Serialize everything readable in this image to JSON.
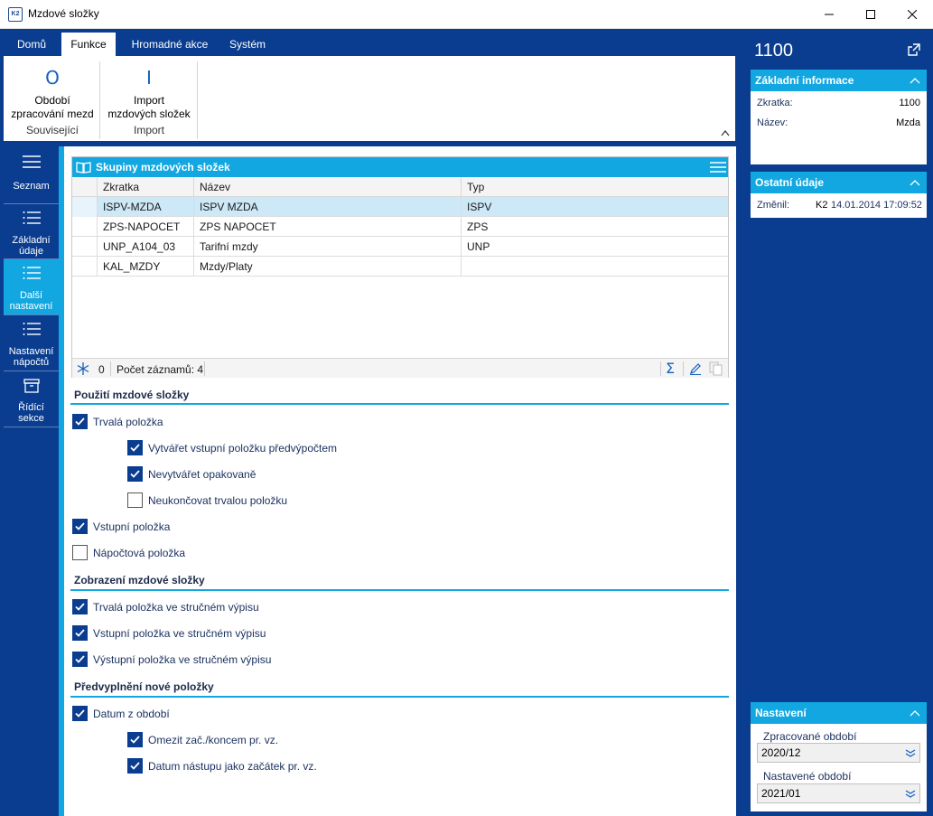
{
  "window": {
    "title": "Mzdové složky",
    "icon_text": "K2"
  },
  "ribbon": {
    "tabs": [
      "Domů",
      "Funkce",
      "Hromadné akce",
      "Systém"
    ],
    "active_tab": "Funkce",
    "buttons": [
      {
        "label_line1": "Období",
        "label_line2": "zpracování mezd",
        "icon": "period-icon"
      },
      {
        "label_line1": "Import",
        "label_line2": "mzdových složek",
        "icon": "import-icon"
      }
    ],
    "groups": [
      "Související",
      "Import"
    ]
  },
  "sidenav": {
    "items": [
      {
        "label": "Seznam",
        "active": false
      },
      {
        "label": "Základní údaje",
        "active": false
      },
      {
        "label": "Další nastavení",
        "active": true
      },
      {
        "label": "Nastavení nápočtů",
        "active": false
      },
      {
        "label": "Řídící sekce",
        "active": false
      }
    ]
  },
  "grid": {
    "title": "Skupiny mzdových složek",
    "columns": [
      "Zkratka",
      "Název",
      "Typ"
    ],
    "rows": [
      {
        "zkratka": "ISPV-MZDA",
        "nazev": "ISPV MZDA",
        "typ": "ISPV"
      },
      {
        "zkratka": "ZPS-NAPOCET",
        "nazev": "ZPS NAPOCET",
        "typ": "ZPS"
      },
      {
        "zkratka": "UNP_A104_03",
        "nazev": "Tarifní mzdy",
        "typ": "UNP"
      },
      {
        "zkratka": "KAL_MZDY",
        "nazev": "Mzdy/Platy",
        "typ": ""
      }
    ],
    "footer": {
      "filter_count": "0",
      "record_count": "Počet záznamů: 4"
    }
  },
  "sections": {
    "usage": {
      "title": "Použití mzdové složky",
      "items": [
        {
          "label": "Trvalá položka",
          "checked": true
        },
        {
          "label": "Vytvářet vstupní položku předvýpočtem",
          "checked": true
        },
        {
          "label": "Nevytvářet opakovaně",
          "checked": true
        },
        {
          "label": "Neukončovat trvalou položku",
          "checked": false
        },
        {
          "label": "Vstupní položka",
          "checked": true
        },
        {
          "label": "Nápočtová položka",
          "checked": false
        }
      ]
    },
    "display": {
      "title": "Zobrazení mzdové složky",
      "items": [
        {
          "label": "Trvalá položka ve stručném výpisu",
          "checked": true
        },
        {
          "label": "Vstupní položka ve stručném výpisu",
          "checked": true
        },
        {
          "label": "Výstupní položka ve stručném výpisu",
          "checked": true
        }
      ]
    },
    "prefill": {
      "title": "Předvyplnění nové položky",
      "items": [
        {
          "label": "Datum z období",
          "checked": true
        },
        {
          "label": "Omezit zač./koncem pr. vz.",
          "checked": true
        },
        {
          "label": "Datum nástupu jako začátek pr. vz.",
          "checked": true
        }
      ]
    }
  },
  "right_panel": {
    "record_id": "1100",
    "basic_info": {
      "title": "Základní informace",
      "zkratka_label": "Zkratka:",
      "zkratka_value": "1100",
      "nazev_label": "Název:",
      "nazev_value": "Mzda"
    },
    "other_info": {
      "title": "Ostatní údaje",
      "changed_label": "Změnil:",
      "changed_user": "K2",
      "changed_date": "14.01.2014 17:09:52"
    },
    "settings": {
      "title": "Nastavení",
      "processed_label": "Zpracované období",
      "processed_value": "2020/12",
      "set_label": "Nastavené období",
      "set_value": "2021/01"
    }
  },
  "colors": {
    "navy": "#0a3d8f",
    "accent": "#12a7e0",
    "selected_row": "#cde8f6"
  }
}
